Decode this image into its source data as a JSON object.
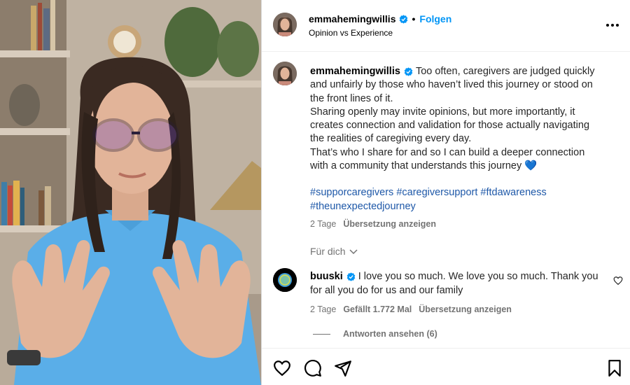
{
  "post": {
    "author": "emmahemingwillis",
    "follow_label": "Folgen",
    "dot": "•",
    "subtitle": "Opinion vs Experience"
  },
  "caption": {
    "username": "emmahemingwillis",
    "lines": [
      "Too often, caregivers are judged quickly",
      "and unfairly by those who haven’t lived this journey or stood on",
      "the front lines of it.",
      "Sharing openly may invite opinions, but more importantly, it",
      "creates connection and validation for those actually navigating",
      "the realities of caregiving every day.",
      "That’s who I share for and so I can build a deeper connection",
      "with a community that understands this journey 💙"
    ],
    "hashtags_line1": "#supporcaregivers #caregiversupport #ftdawareness",
    "hashtags_line2": "#theunexpectedjourney",
    "time": "2 Tage",
    "translate_label": "Übersetzung anzeigen"
  },
  "for_you": "Für dich",
  "comment": {
    "username": "buuski",
    "text_line1": "I love you so much. We love you so much. Thank you",
    "text_line2": "for all you do for us and our family",
    "time": "2 Tage",
    "likes": "Gefällt 1.772 Mal",
    "translate_label": "Übersetzung anzeigen",
    "view_replies": "Antworten ansehen (6)"
  },
  "icons": {
    "verified": "verified-badge-icon",
    "more": "more-options-icon",
    "chevron": "chevron-down-icon",
    "heart": "heart-icon",
    "comment": "comment-icon",
    "share": "share-icon",
    "save": "bookmark-icon"
  },
  "colors": {
    "accent": "#0095f6",
    "hashtag": "#1e58a8",
    "muted": "#737373",
    "heart_emoji": "#4a90e2",
    "shirt": "#5aaee8"
  }
}
